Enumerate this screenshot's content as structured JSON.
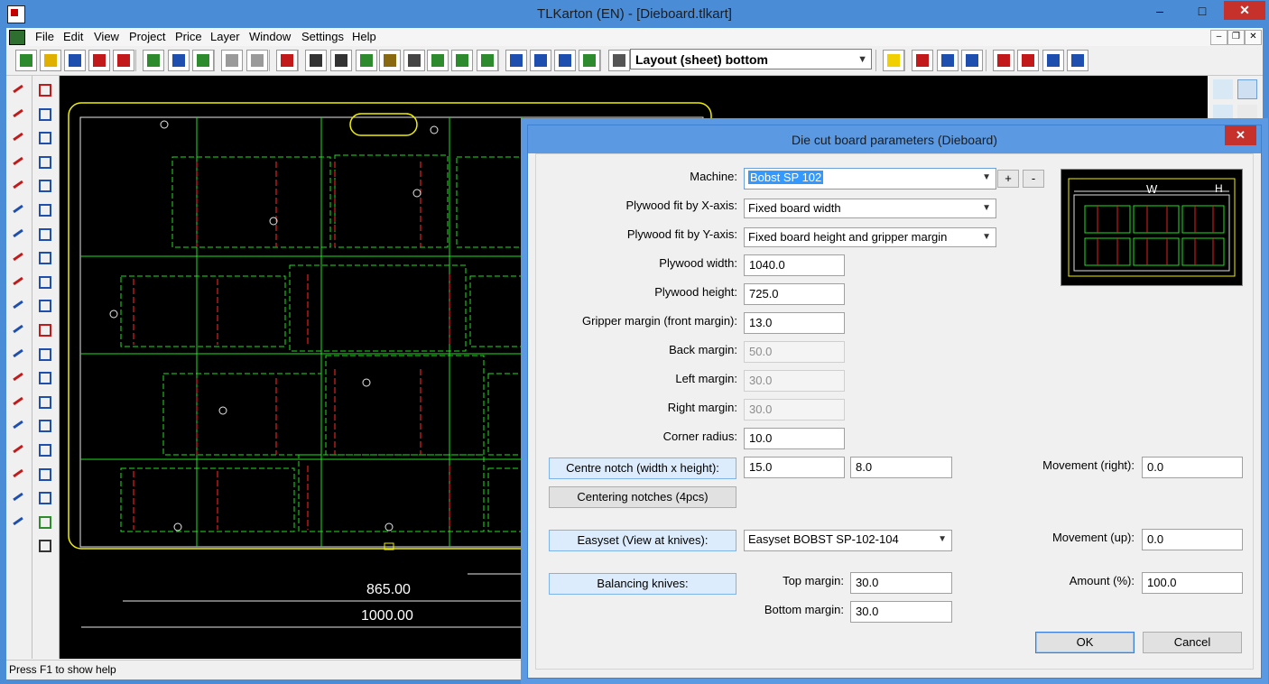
{
  "window": {
    "title": "TLKarton (EN) - [Dieboard.tlkart]",
    "minimize": "–",
    "maximize": "□",
    "close": "✕"
  },
  "menu": [
    "File",
    "Edit",
    "View",
    "Project",
    "Price",
    "Layer",
    "Window",
    "Settings",
    "Help"
  ],
  "toolbar": {
    "layout_select": "Layout (sheet) bottom",
    "icons": [
      "new-icon",
      "open-icon",
      "save-icon",
      "export-dxf-icon",
      "import-dxf-icon",
      "print-icon",
      "cut-icon",
      "download-icon",
      "printer-icon",
      "printer2-icon",
      "help-icon",
      "50-icon",
      "50b-icon",
      "layout-icon",
      "sheet-icon",
      "knife-icon",
      "grid-icon",
      "grid2-icon",
      "grid3-icon",
      "zoom-out-icon",
      "zoom-in-icon",
      "zoom-fit-icon",
      "screen-icon",
      "500ef-icon",
      "note-icon",
      "delete-icon",
      "arrow-left-icon",
      "arrow-right-icon",
      "percent-icon",
      "percent-doc-icon",
      "bar-arrow-icon",
      "percent2-icon"
    ]
  },
  "canvas": {
    "dim1": "865.00",
    "dim2": "1000.00"
  },
  "status": "Press F1 to show help",
  "dialog": {
    "title": "Die cut board parameters (Dieboard)",
    "close": "✕",
    "machine_label": "Machine:",
    "machine_value": "Bobst SP 102",
    "plus": "+",
    "minus": "-",
    "fit_x_label": "Plywood fit by X-axis:",
    "fit_x_value": "Fixed board width",
    "fit_y_label": "Plywood fit by Y-axis:",
    "fit_y_value": "Fixed board height and gripper margin",
    "width_label": "Plywood width:",
    "width_value": "1040.0",
    "height_label": "Plywood height:",
    "height_value": "725.0",
    "gripper_label": "Gripper margin (front margin):",
    "gripper_value": "13.0",
    "back_label": "Back margin:",
    "back_value": "50.0",
    "left_label": "Left margin:",
    "left_value": "30.0",
    "right_label": "Right margin:",
    "right_value": "30.0",
    "corner_label": "Corner radius:",
    "corner_value": "10.0",
    "centre_notch_btn": "Centre notch (width x height):",
    "notch_w": "15.0",
    "notch_h": "8.0",
    "movement_right_label": "Movement (right):",
    "movement_right_value": "0.0",
    "centering_btn": "Centering notches (4pcs)",
    "easyset_btn": "Easyset (View at knives):",
    "easyset_value": "Easyset BOBST SP-102-104",
    "movement_up_label": "Movement (up):",
    "movement_up_value": "0.0",
    "balancing_btn": "Balancing knives:",
    "top_margin_label": "Top margin:",
    "top_margin_value": "30.0",
    "bottom_margin_label": "Bottom margin:",
    "bottom_margin_value": "30.0",
    "amount_label": "Amount (%):",
    "amount_value": "100.0",
    "ok": "OK",
    "cancel": "Cancel",
    "preview_w": "W",
    "preview_h": "H"
  },
  "colors": {
    "titlebar": "#4a8cd6",
    "cut_line": "#e02020",
    "crease_line": "#20e020",
    "board_outline": "#f0f000",
    "canvas": "#000000"
  }
}
